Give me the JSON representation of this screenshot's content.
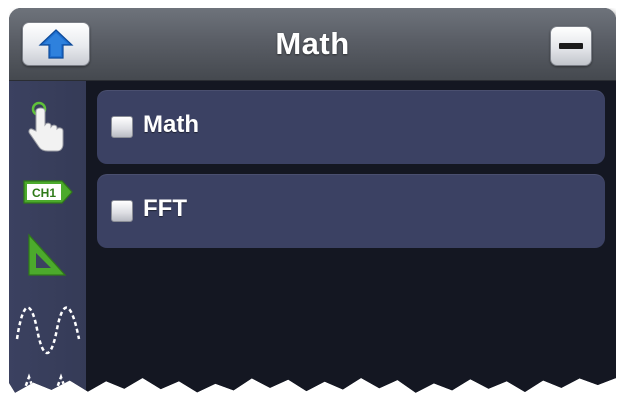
{
  "window": {
    "title": "Math"
  },
  "toolbar": {
    "back_icon": "up-arrow-icon",
    "minimize_icon": "minus-icon"
  },
  "sidebar": {
    "items": [
      {
        "icon": "touch-hand-icon"
      },
      {
        "icon": "channel-badge-icon",
        "label": "CH1"
      },
      {
        "icon": "triangle-ruler-icon"
      },
      {
        "icon": "sine-wave-icon"
      },
      {
        "icon": "pulse-wave-icon"
      }
    ]
  },
  "options": [
    {
      "label": "Math",
      "checked": false
    },
    {
      "label": "FFT",
      "checked": false
    }
  ],
  "colors": {
    "titlebar": "#5a5e66",
    "row_background": "#3b4163",
    "sidebar": "#3b4160",
    "content_background": "#141722",
    "accent_blue": "#1e6fd0",
    "icon_green": "#4caa2c"
  }
}
